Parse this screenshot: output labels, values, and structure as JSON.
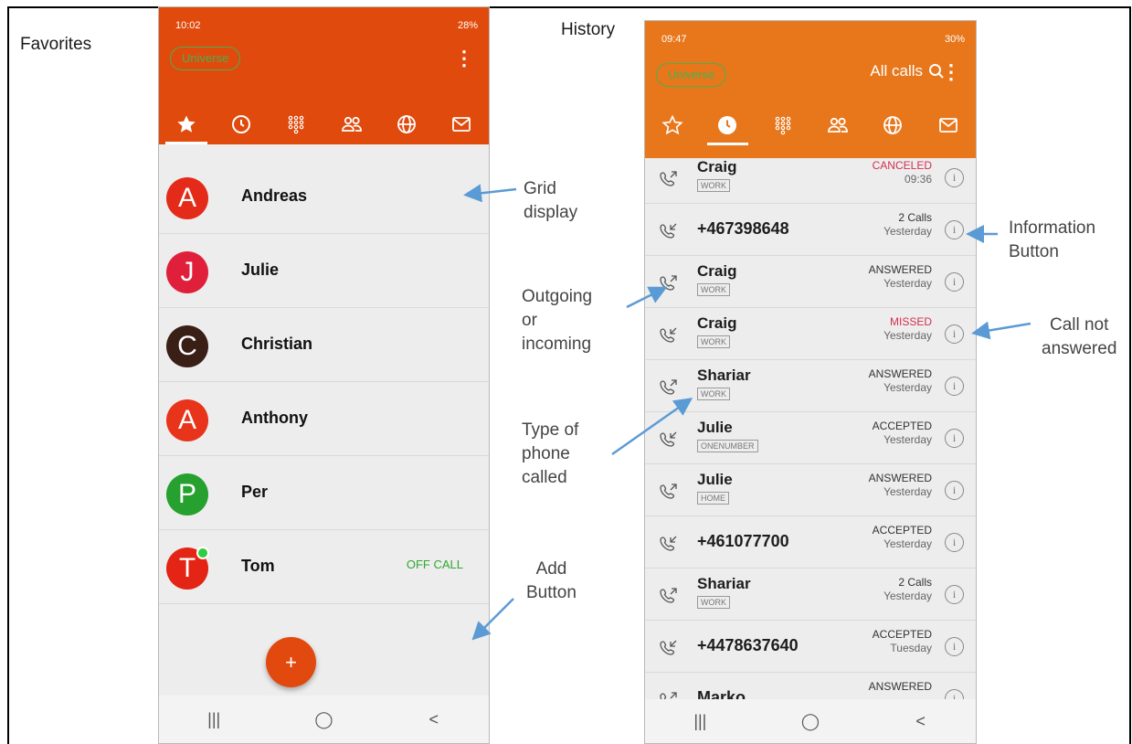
{
  "labels": {
    "favorites": "Favorites",
    "history": "History"
  },
  "annotations": {
    "grid_line1": "Grid",
    "grid_line2": "display",
    "outgoing_line1": "Outgoing",
    "outgoing_line2": "or",
    "outgoing_line3": "incoming",
    "type_line1": "Type of",
    "type_line2": "phone",
    "type_line3": "called",
    "add_line1": "Add",
    "add_line2": "Button",
    "info_line1": "Information",
    "info_line2": "Button",
    "notans_line1": "Call not",
    "notans_line2": "answered"
  },
  "colors": {
    "favorites_bar": "#e04a0d",
    "history_bar": "#e8771c",
    "missed": "#d32f4f",
    "off_call": "#2fa830",
    "brand_pill": "#4caf50"
  },
  "favorites": {
    "status_time": "10:02",
    "status_right": "28%",
    "brand": "Universe",
    "kebab": "⋮",
    "tabs": [
      "star-icon",
      "clock-icon",
      "keypad-icon",
      "contacts-icon",
      "globe-icon",
      "mail-icon"
    ],
    "active_tab": "star-icon",
    "contacts": [
      {
        "initial": "A",
        "name": "Andreas",
        "color": "#e42b1a",
        "status": ""
      },
      {
        "initial": "J",
        "name": "Julie",
        "color": "#e0203b",
        "status": ""
      },
      {
        "initial": "C",
        "name": "Christian",
        "color": "#3a1f17",
        "status": ""
      },
      {
        "initial": "A",
        "name": "Anthony",
        "color": "#e8341a",
        "status": ""
      },
      {
        "initial": "P",
        "name": "Per",
        "color": "#26a02e",
        "status": ""
      },
      {
        "initial": "T",
        "name": "Tom",
        "color": "#e42414",
        "status": "OFF CALL"
      }
    ],
    "fab": "+",
    "nav": [
      "|||",
      "◯",
      "<"
    ]
  },
  "history": {
    "status_time": "09:47",
    "status_right": "30%",
    "brand": "Universe",
    "calls_title": "All calls",
    "kebab": "⋮",
    "tabs": [
      "star-outline-icon",
      "clock-icon",
      "keypad-icon",
      "contacts-icon",
      "globe-icon",
      "mail-icon"
    ],
    "active_tab": "clock-icon",
    "calls": [
      {
        "name": "Craig",
        "tag": "WORK",
        "status": "CANCELED",
        "when": "09:36",
        "direction": "outgoing",
        "status_color": "#d32f4f"
      },
      {
        "name": "+467398648",
        "tag": "",
        "status": "2 Calls",
        "when": "Yesterday",
        "direction": "incoming",
        "status_color": "#333333"
      },
      {
        "name": "Craig",
        "tag": "WORK",
        "status": "ANSWERED",
        "when": "Yesterday",
        "direction": "outgoing",
        "status_color": "#333333"
      },
      {
        "name": "Craig",
        "tag": "WORK",
        "status": "MISSED",
        "when": "Yesterday",
        "direction": "incoming",
        "status_color": "#d32f4f"
      },
      {
        "name": "Shariar",
        "tag": "WORK",
        "status": "ANSWERED",
        "when": "Yesterday",
        "direction": "outgoing",
        "status_color": "#333333"
      },
      {
        "name": "Julie",
        "tag": "ONENUMBER",
        "status": "ACCEPTED",
        "when": "Yesterday",
        "direction": "incoming",
        "status_color": "#333333"
      },
      {
        "name": "Julie",
        "tag": "HOME",
        "status": "ANSWERED",
        "when": "Yesterday",
        "direction": "outgoing",
        "status_color": "#333333"
      },
      {
        "name": "+461077700",
        "tag": "",
        "status": "ACCEPTED",
        "when": "Yesterday",
        "direction": "incoming",
        "status_color": "#333333"
      },
      {
        "name": "Shariar",
        "tag": "WORK",
        "status": "2 Calls",
        "when": "Yesterday",
        "direction": "outgoing",
        "status_color": "#333333"
      },
      {
        "name": "+4478637640",
        "tag": "",
        "status": "ACCEPTED",
        "when": "Tuesday",
        "direction": "incoming",
        "status_color": "#333333"
      },
      {
        "name": "Marko",
        "tag": "",
        "status": "ANSWERED",
        "when": "",
        "direction": "outgoing",
        "status_color": "#333333"
      }
    ],
    "info_glyph": "i",
    "nav": [
      "|||",
      "◯",
      "<"
    ]
  }
}
